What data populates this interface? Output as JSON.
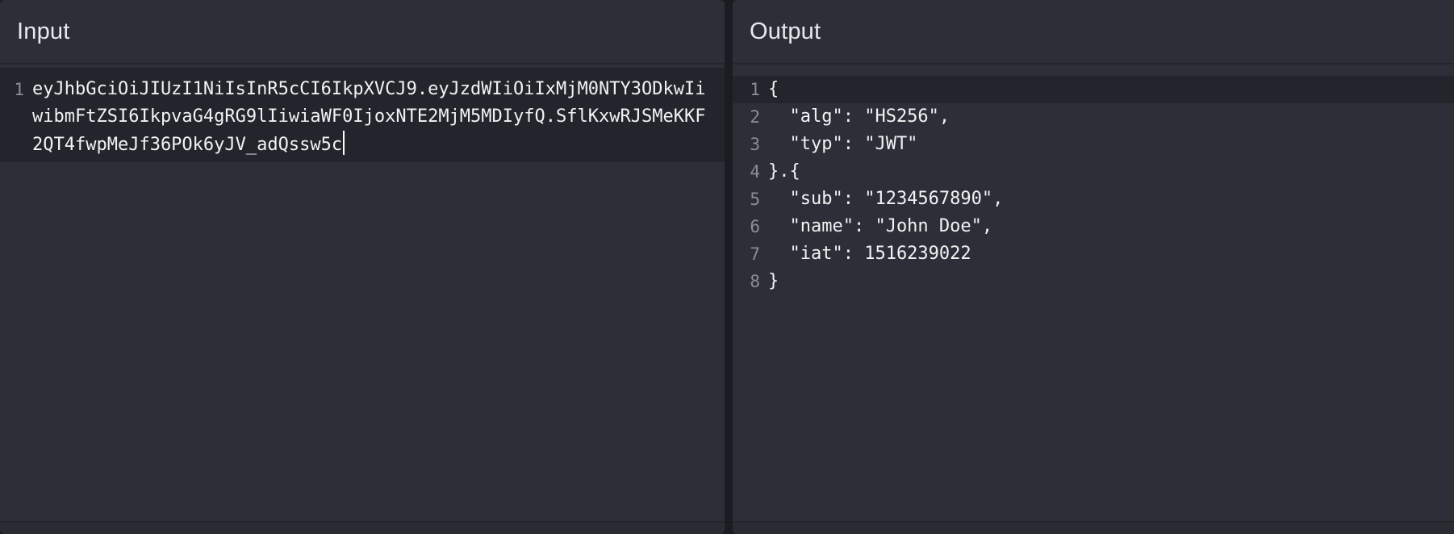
{
  "input": {
    "title": "Input",
    "lines": [
      {
        "number": "1",
        "text": "eyJhbGciOiJIUzI1NiIsInR5cCI6IkpXVCJ9.eyJzdWIiOiIxMjM0NTY3ODkwIiwibmFtZSI6IkpvaG4gRG9lIiwiaWF0IjoxNTE2MjM5MDIyfQ.SflKxwRJSMeKKF2QT4fwpMeJf36POk6yJV_adQssw5c"
      }
    ]
  },
  "output": {
    "title": "Output",
    "lines": [
      {
        "number": "1",
        "text": "{"
      },
      {
        "number": "2",
        "text": "  \"alg\": \"HS256\","
      },
      {
        "number": "3",
        "text": "  \"typ\": \"JWT\""
      },
      {
        "number": "4",
        "text": "}.{"
      },
      {
        "number": "5",
        "text": "  \"sub\": \"1234567890\","
      },
      {
        "number": "6",
        "text": "  \"name\": \"John Doe\","
      },
      {
        "number": "7",
        "text": "  \"iat\": 1516239022"
      },
      {
        "number": "8",
        "text": "}"
      }
    ]
  },
  "colors": {
    "background": "#1b1c21",
    "panel": "#2d2f38",
    "active_line": "#23252c",
    "text": "#f2f2f4",
    "gutter_text": "#8a8d96"
  }
}
